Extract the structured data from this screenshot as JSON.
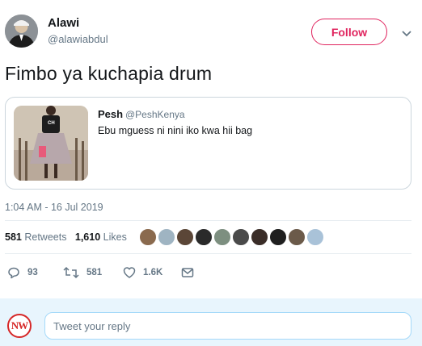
{
  "author": {
    "name": "Alawi",
    "handle": "@alawiabdul",
    "follow_label": "Follow"
  },
  "tweet": {
    "text": "Fimbo ya kuchapia drum",
    "timestamp": "1:04 AM - 16 Jul 2019"
  },
  "quoted": {
    "name": "Pesh",
    "handle": "@PeshKenya",
    "text": "Ebu mguess ni nini iko kwa hii bag",
    "shirt_text": "CH"
  },
  "stats": {
    "retweets_count": "581",
    "retweets_label": "Retweets",
    "likes_count": "1,610",
    "likes_label": "Likes",
    "liker_avatar_count": 10
  },
  "actions": {
    "replies": "93",
    "retweets": "581",
    "likes": "1.6K"
  },
  "reply": {
    "avatar_text": "NW",
    "placeholder": "Tweet your reply"
  },
  "colors": {
    "accent": "#e0245e",
    "muted": "#657786",
    "border": "#ccd6dd",
    "reply_bg": "#e8f5fd"
  },
  "icons": [
    "chevron-down-icon",
    "reply-icon",
    "retweet-icon",
    "like-icon",
    "dm-icon"
  ]
}
